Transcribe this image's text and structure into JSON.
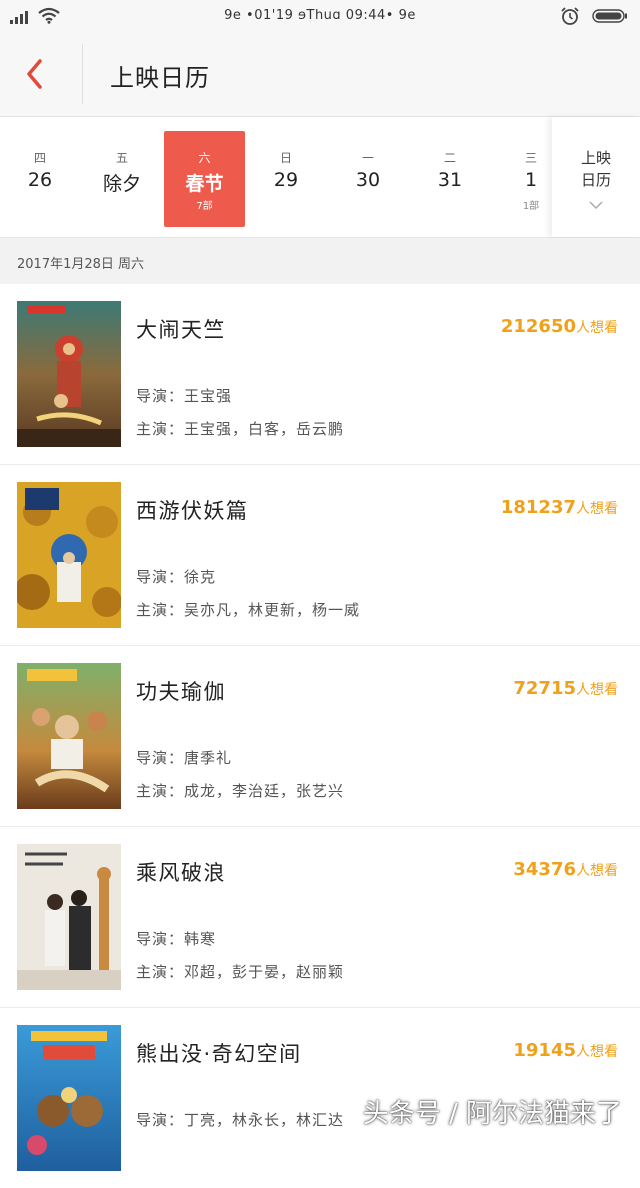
{
  "status": {
    "center_text": "9e •01'19 ɘThuɑ 09:44• 9e",
    "icons": [
      "signal-icon",
      "wifi-icon",
      "alarm-icon",
      "battery-icon"
    ]
  },
  "header": {
    "title": "上映日历",
    "back_icon": "chevron-left-icon"
  },
  "calendar": {
    "days": [
      {
        "weekday": "四",
        "date": "26",
        "count": ""
      },
      {
        "weekday": "五",
        "date": "除夕",
        "count": ""
      },
      {
        "weekday": "六",
        "date": "春节",
        "count": "7部",
        "selected": true
      },
      {
        "weekday": "日",
        "date": "29",
        "count": ""
      },
      {
        "weekday": "一",
        "date": "30",
        "count": ""
      },
      {
        "weekday": "二",
        "date": "31",
        "count": ""
      },
      {
        "weekday": "三",
        "date": "1",
        "count": "1部"
      }
    ],
    "more_line1": "上映",
    "more_line2": "日历"
  },
  "date_label": "2017年1月28日 周六",
  "movies": [
    {
      "title": "大闹天竺",
      "want_count": "212650",
      "want_suffix": "人想看",
      "director": "导演：王宝强",
      "cast": "主演：王宝强，白客，岳云鹏"
    },
    {
      "title": "西游伏妖篇",
      "want_count": "181237",
      "want_suffix": "人想看",
      "director": "导演：徐克",
      "cast": "主演：吴亦凡，林更新，杨一威"
    },
    {
      "title": "功夫瑜伽",
      "want_count": "72715",
      "want_suffix": "人想看",
      "director": "导演：唐季礼",
      "cast": "主演：成龙，李治廷，张艺兴"
    },
    {
      "title": "乘风破浪",
      "want_count": "34376",
      "want_suffix": "人想看",
      "director": "导演：韩寒",
      "cast": "主演：邓超，彭于晏，赵丽颖"
    },
    {
      "title": "熊出没·奇幻空间",
      "want_count": "19145",
      "want_suffix": "人想看",
      "director": "导演：丁亮，林永长，林汇达",
      "cast": ""
    }
  ],
  "colors": {
    "accent": "#ee5a4b",
    "want": "#f0a019"
  },
  "watermark": "头条号 / 阿尔法猫来了"
}
